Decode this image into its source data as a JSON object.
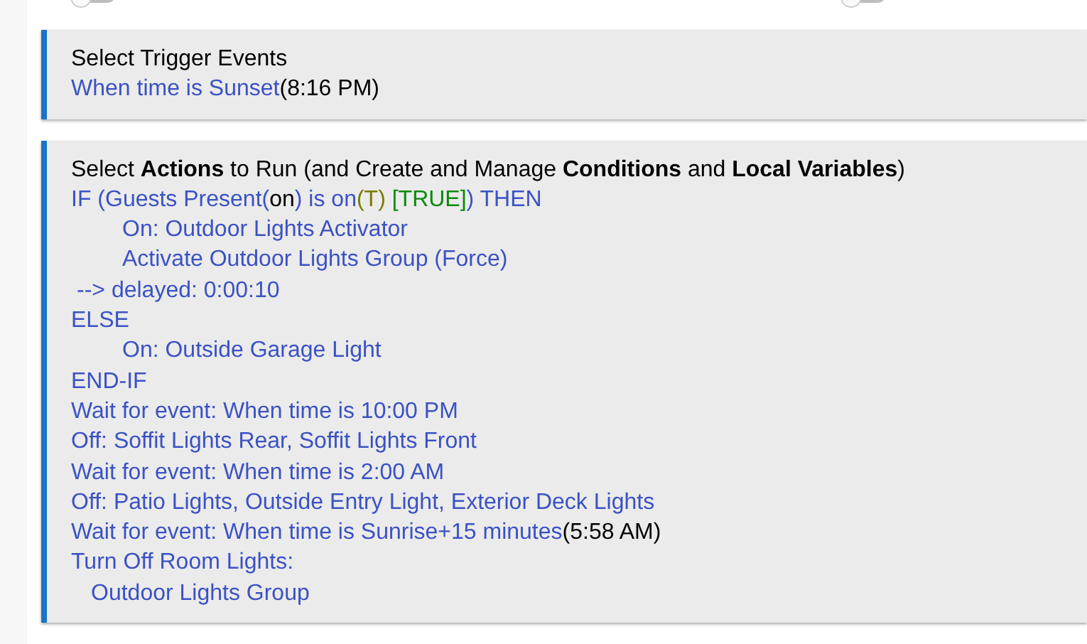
{
  "switches": [
    {
      "on": false
    },
    {
      "on": false
    }
  ],
  "trigger_panel": {
    "heading": "Select Trigger Events",
    "lines": [
      {
        "kind": "line",
        "segments": [
          {
            "text": "When time is Sunset",
            "color": "#3b52c4"
          },
          {
            "text": "(8:16 PM)",
            "color": "#000000"
          }
        ]
      }
    ]
  },
  "actions_panel": {
    "heading": "Select **Actions** to Run (and Create and Manage **Conditions** and **Local Variables**)",
    "lines": [
      {
        "kind": "line",
        "segments": [
          {
            "text": "IF (Guests Present(",
            "color": "#3b52c4"
          },
          {
            "text": "on",
            "color": "#000000"
          },
          {
            "text": ") is on",
            "color": "#3b52c4"
          },
          {
            "text": "(T)",
            "color": "#7a7a00"
          },
          {
            "text": " [TRUE]",
            "color": "#0a8a0a"
          },
          {
            "text": ") THEN",
            "color": "#3b52c4"
          }
        ],
        "children": [
          {
            "kind": "step",
            "segments": [
              {
                "text": "On: Outdoor Lights Activator",
                "color": "#3b52c4"
              }
            ]
          },
          {
            "kind": "step",
            "segments": [
              {
                "text": "Activate Outdoor Lights Group (Force)",
                "color": "#3b52c4"
              }
            ]
          }
        ]
      },
      {
        "kind": "delay",
        "segments": [
          {
            "text": "--> delayed: 0:00:10",
            "color": "#3b52c4"
          }
        ]
      },
      {
        "kind": "line",
        "segments": [
          {
            "text": "ELSE",
            "color": "#3b52c4"
          }
        ],
        "children": [
          {
            "kind": "step",
            "segments": [
              {
                "text": "On: Outside Garage Light",
                "color": "#3b52c4"
              }
            ]
          }
        ]
      },
      {
        "kind": "line",
        "segments": [
          {
            "text": "END-IF",
            "color": "#3b52c4"
          }
        ]
      },
      {
        "kind": "line",
        "segments": [
          {
            "text": "Wait for event: When time is 10:00 PM",
            "color": "#3b52c4"
          }
        ]
      },
      {
        "kind": "line",
        "segments": [
          {
            "text": "Off: Soffit Lights Rear, Soffit Lights Front",
            "color": "#3b52c4"
          }
        ]
      },
      {
        "kind": "line",
        "segments": [
          {
            "text": "Wait for event: When time is 2:00 AM",
            "color": "#3b52c4"
          }
        ]
      },
      {
        "kind": "line",
        "segments": [
          {
            "text": "Off: Patio Lights, Outside Entry Light, Exterior Deck Lights",
            "color": "#3b52c4"
          }
        ]
      },
      {
        "kind": "line",
        "segments": [
          {
            "text": "Wait for event: When time is Sunrise+15 minutes",
            "color": "#3b52c4"
          },
          {
            "text": "(5:58 AM)",
            "color": "#000000"
          }
        ]
      },
      {
        "kind": "line",
        "segments": [
          {
            "text": "Turn Off Room Lights:",
            "color": "#3b52c4"
          }
        ],
        "children": [
          {
            "kind": "device",
            "segments": [
              {
                "text": "Outdoor Lights Group",
                "color": "#3b52c4"
              }
            ]
          }
        ]
      }
    ]
  }
}
